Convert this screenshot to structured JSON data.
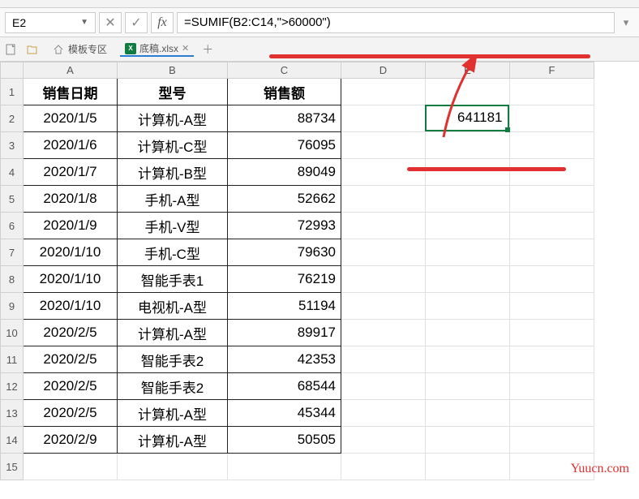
{
  "formula_bar": {
    "name_box": "E2",
    "formula": "=SUMIF(B2:C14,\">60000\")",
    "cancel_icon": "✕",
    "confirm_icon": "✓",
    "fx_icon": "fx"
  },
  "tabs": {
    "template_label": "模板专区",
    "file_label": "底稿.xlsx"
  },
  "columns": [
    "A",
    "B",
    "C",
    "D",
    "E",
    "F"
  ],
  "rows": [
    1,
    2,
    3,
    4,
    5,
    6,
    7,
    8,
    9,
    10,
    11,
    12,
    13,
    14,
    15
  ],
  "table": {
    "headers": {
      "date": "销售日期",
      "model": "型号",
      "amount": "销售额"
    },
    "data": [
      {
        "date": "2020/1/5",
        "model": "计算机-A型",
        "amount": 88734
      },
      {
        "date": "2020/1/6",
        "model": "计算机-C型",
        "amount": 76095
      },
      {
        "date": "2020/1/7",
        "model": "计算机-B型",
        "amount": 89049
      },
      {
        "date": "2020/1/8",
        "model": "手机-A型",
        "amount": 52662
      },
      {
        "date": "2020/1/9",
        "model": "手机-V型",
        "amount": 72993
      },
      {
        "date": "2020/1/10",
        "model": "手机-C型",
        "amount": 79630
      },
      {
        "date": "2020/1/10",
        "model": "智能手表1",
        "amount": 76219
      },
      {
        "date": "2020/1/10",
        "model": "电视机-A型",
        "amount": 51194
      },
      {
        "date": "2020/2/5",
        "model": "计算机-A型",
        "amount": 89917
      },
      {
        "date": "2020/2/5",
        "model": "智能手表2",
        "amount": 42353
      },
      {
        "date": "2020/2/5",
        "model": "智能手表2",
        "amount": 68544
      },
      {
        "date": "2020/2/5",
        "model": "计算机-A型",
        "amount": 45344
      },
      {
        "date": "2020/2/9",
        "model": "计算机-A型",
        "amount": 50505
      }
    ]
  },
  "result_cell": {
    "ref": "E2",
    "value": 641181
  },
  "watermark": "Yuucn.com",
  "annotation_color": "#e03030"
}
